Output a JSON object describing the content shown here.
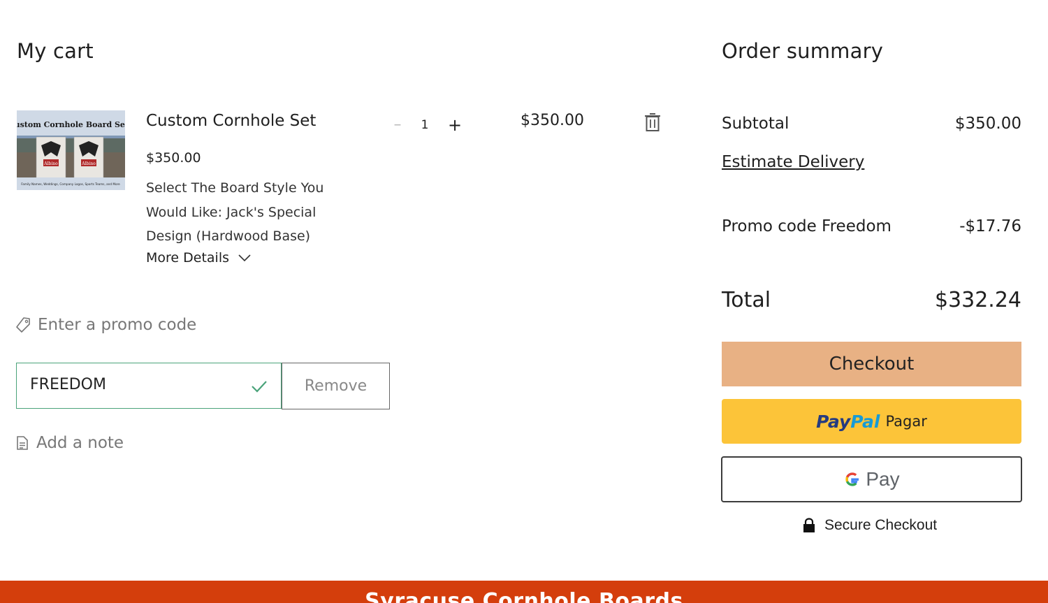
{
  "cart": {
    "title": "My cart",
    "item": {
      "name": "Custom Cornhole Set",
      "price": "$350.00",
      "option": "Select The Board Style You Would Like: Jack's Special Design (Hardwood Base)",
      "more_details": "More Details",
      "quantity": "1",
      "minus": "–",
      "plus": "+",
      "line_total": "$350.00",
      "image": {
        "heading": "Custom Cornhole Board Sets",
        "board_text": "Albino",
        "caption": "Family Names, Weddings, Company Logos, Sports Teams, and More"
      }
    },
    "promo": {
      "link": "Enter a promo code",
      "value": "FREEDOM",
      "remove": "Remove"
    },
    "note": {
      "link": "Add a note"
    }
  },
  "summary": {
    "title": "Order summary",
    "subtotal_label": "Subtotal",
    "subtotal_value": "$350.00",
    "estimate_delivery": "Estimate Delivery",
    "promo_label": "Promo code Freedom",
    "promo_value": "-$17.76",
    "total_label": "Total",
    "total_value": "$332.24",
    "checkout": "Checkout",
    "paypal_logo_a": "Pay",
    "paypal_logo_b": "Pal",
    "paypal_text": "Pagar",
    "gpay_text": "Pay",
    "secure": "Secure Checkout"
  },
  "banner": {
    "text": "Syracuse Cornhole Boards"
  },
  "colors": {
    "accent_checkout": "#e8b184",
    "paypal_yellow": "#fcc439",
    "banner": "#d43e0c",
    "promo_valid": "#4aa37a"
  },
  "icons": [
    "minus-icon",
    "plus-icon",
    "trash-icon",
    "chevron-down-icon",
    "tag-icon",
    "checkmark-icon",
    "note-icon",
    "google-g-icon",
    "lock-icon"
  ]
}
